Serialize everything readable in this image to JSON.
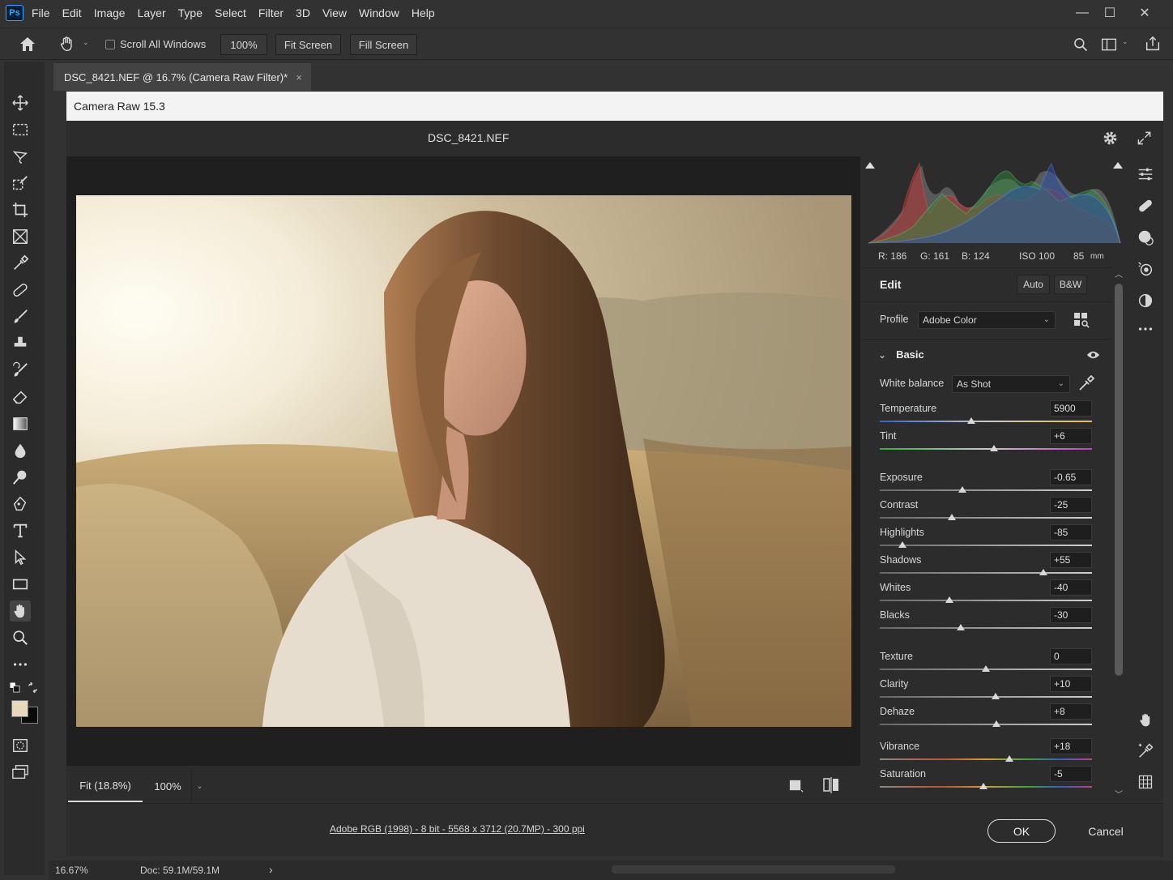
{
  "menubar": {
    "logo": "Ps",
    "items": [
      "File",
      "Edit",
      "Image",
      "Layer",
      "Type",
      "Select",
      "Filter",
      "3D",
      "View",
      "Window",
      "Help"
    ],
    "minimize": "—",
    "maximize": "☐",
    "close": "✕"
  },
  "options": {
    "scroll_all_windows": "Scroll All Windows",
    "zoom_100": "100%",
    "fit_screen": "Fit Screen",
    "fill_screen": "Fill Screen"
  },
  "document_tab": {
    "title": "DSC_8421.NEF @ 16.7% (Camera Raw Filter)*",
    "close": "×"
  },
  "dialog": {
    "title": "Camera Raw 15.3",
    "filename": "DSC_8421.NEF",
    "fit_label": "Fit (18.8%)",
    "zoom_label": "100%",
    "workflow_info": "Adobe RGB (1998) - 8 bit - 5568 x 3712 (20.7MP) - 300 ppi",
    "ok": "OK",
    "cancel": "Cancel"
  },
  "histogram": {
    "r": "R: 186",
    "g": "G: 161",
    "b": "B: 124",
    "iso": "ISO 100",
    "focal": "85",
    "focal_unit": "mm"
  },
  "edit": {
    "title": "Edit",
    "auto": "Auto",
    "bw": "B&W",
    "profile_label": "Profile",
    "profile_value": "Adobe Color",
    "basic_title": "Basic",
    "wb_label": "White balance",
    "wb_value": "As Shot",
    "sliders": [
      {
        "label": "Temperature",
        "value": "5900",
        "pos": 0.43
      },
      {
        "label": "Tint",
        "value": "+6",
        "pos": 0.54
      },
      {
        "label": "Exposure",
        "value": "-0.65",
        "pos": 0.39
      },
      {
        "label": "Contrast",
        "value": "-25",
        "pos": 0.34
      },
      {
        "label": "Highlights",
        "value": "-85",
        "pos": 0.105
      },
      {
        "label": "Shadows",
        "value": "+55",
        "pos": 0.77
      },
      {
        "label": "Whites",
        "value": "-40",
        "pos": 0.33
      },
      {
        "label": "Blacks",
        "value": "-30",
        "pos": 0.38
      },
      {
        "label": "Texture",
        "value": "0",
        "pos": 0.5
      },
      {
        "label": "Clarity",
        "value": "+10",
        "pos": 0.545
      },
      {
        "label": "Dehaze",
        "value": "+8",
        "pos": 0.55
      },
      {
        "label": "Vibrance",
        "value": "+18",
        "pos": 0.61
      },
      {
        "label": "Saturation",
        "value": "-5",
        "pos": 0.49
      }
    ]
  },
  "status": {
    "zoom": "16.67%",
    "doc": "Doc: 59.1M/59.1M",
    "arrow": "›"
  }
}
